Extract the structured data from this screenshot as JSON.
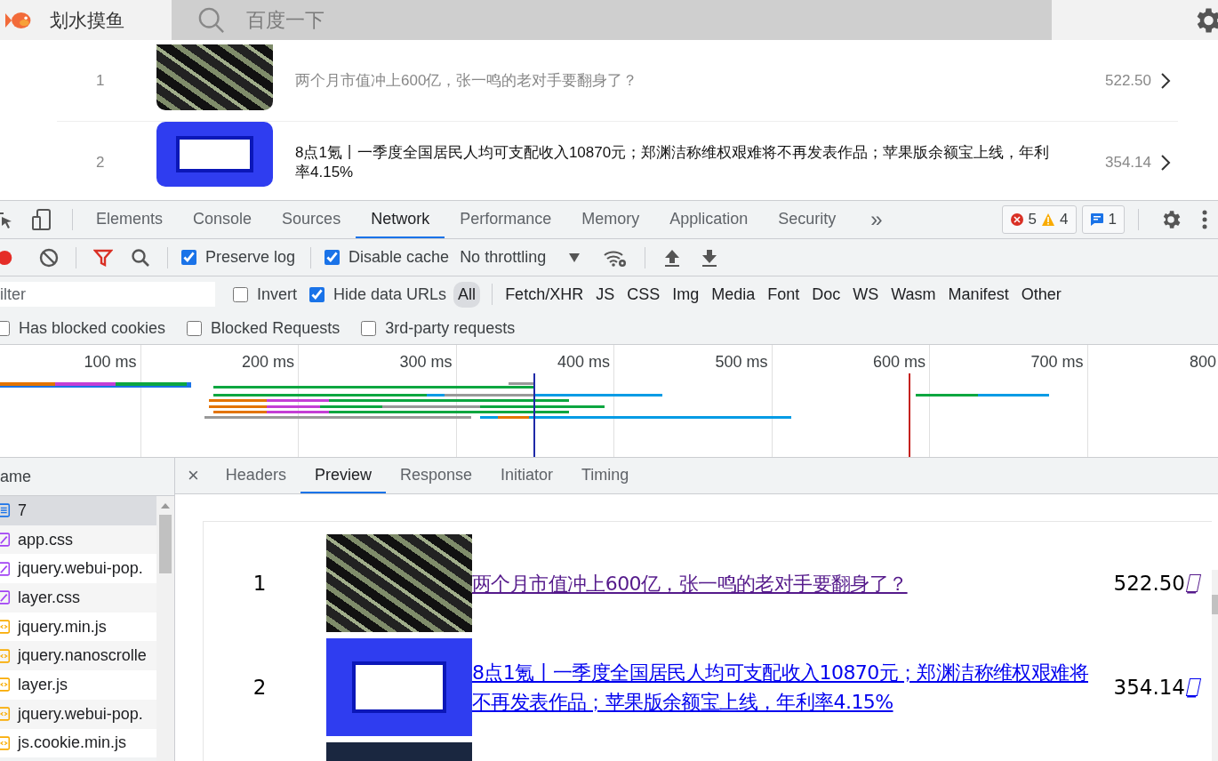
{
  "page": {
    "brand": "划水摸鱼",
    "search": {
      "placeholder": "百度一下"
    },
    "items": [
      {
        "rank": "1",
        "kind": "photo",
        "title": "两个月市值冲上600亿，张一鸣的老对手要翻身了？",
        "score": "522.50",
        "visited": true
      },
      {
        "rank": "2",
        "kind": "banner",
        "title": "8点1氪丨一季度全国居民人均可支配收入10870元；郑渊洁称维权艰难将不再发表作品；苹果版余额宝上线，年利率4.15%",
        "score": "354.14",
        "visited": false
      }
    ]
  },
  "devtools": {
    "tabs": [
      {
        "label": "Elements",
        "selected": false
      },
      {
        "label": "Console",
        "selected": false
      },
      {
        "label": "Sources",
        "selected": false
      },
      {
        "label": "Network",
        "selected": true
      },
      {
        "label": "Performance",
        "selected": false
      },
      {
        "label": "Memory",
        "selected": false
      },
      {
        "label": "Application",
        "selected": false
      },
      {
        "label": "Security",
        "selected": false
      }
    ],
    "more_tabs": "»",
    "errors": "5",
    "warnings": "4",
    "messages": "1",
    "toolbar": {
      "recording": true,
      "preserve_log": {
        "label": "Preserve log",
        "checked": true
      },
      "disable_cache": {
        "label": "Disable cache",
        "checked": true
      },
      "throttling": "No throttling"
    },
    "filter": {
      "placeholder": "ilter",
      "invert": {
        "label": "Invert",
        "checked": false
      },
      "hide_data_urls": {
        "label": "Hide data URLs",
        "checked": true
      },
      "types": [
        {
          "label": "All",
          "selected": true
        },
        {
          "label": "Fetch/XHR",
          "selected": false
        },
        {
          "label": "JS",
          "selected": false
        },
        {
          "label": "CSS",
          "selected": false
        },
        {
          "label": "Img",
          "selected": false
        },
        {
          "label": "Media",
          "selected": false
        },
        {
          "label": "Font",
          "selected": false
        },
        {
          "label": "Doc",
          "selected": false
        },
        {
          "label": "WS",
          "selected": false
        },
        {
          "label": "Wasm",
          "selected": false
        },
        {
          "label": "Manifest",
          "selected": false
        },
        {
          "label": "Other",
          "selected": false
        }
      ]
    },
    "blocked_filters": [
      {
        "label": "Has blocked cookies",
        "checked": false
      },
      {
        "label": "Blocked Requests",
        "checked": false
      },
      {
        "label": "3rd-party requests",
        "checked": false
      }
    ],
    "overview_ticks": [
      "100 ms",
      "200 ms",
      "300 ms",
      "400 ms",
      "500 ms",
      "600 ms",
      "700 ms",
      "800"
    ],
    "requests": {
      "header": "ame",
      "items": [
        {
          "name": "7",
          "kind": "doc",
          "selected": true
        },
        {
          "name": "app.css",
          "kind": "css",
          "selected": false
        },
        {
          "name": "jquery.webui-pop.",
          "kind": "css",
          "selected": false
        },
        {
          "name": "layer.css",
          "kind": "css",
          "selected": false
        },
        {
          "name": "jquery.min.js",
          "kind": "js",
          "selected": false
        },
        {
          "name": "jquery.nanoscrolle",
          "kind": "js",
          "selected": false
        },
        {
          "name": "layer.js",
          "kind": "js",
          "selected": false
        },
        {
          "name": "jquery.webui-pop.",
          "kind": "js",
          "selected": false
        },
        {
          "name": "js.cookie.min.js",
          "kind": "js",
          "selected": false
        }
      ]
    },
    "close_glyph": "×",
    "detail_tabs": [
      {
        "label": "Headers",
        "selected": false
      },
      {
        "label": "Preview",
        "selected": true
      },
      {
        "label": "Response",
        "selected": false
      },
      {
        "label": "Initiator",
        "selected": false
      },
      {
        "label": "Timing",
        "selected": false
      }
    ],
    "preview": [
      {
        "rank": "1",
        "kind": "photo",
        "title": "两个月市值冲上600亿，张一鸣的老对手要翻身了？",
        "score": "522.50",
        "visited": true
      },
      {
        "rank": "2",
        "kind": "banner",
        "title": "8点1氪丨一季度全国居民人均可支配收入10870元；郑渊洁称维权艰难将不再发表作品；苹果版余额宝上线，年利率4.15%",
        "score": "354.14",
        "visited": false
      }
    ]
  }
}
